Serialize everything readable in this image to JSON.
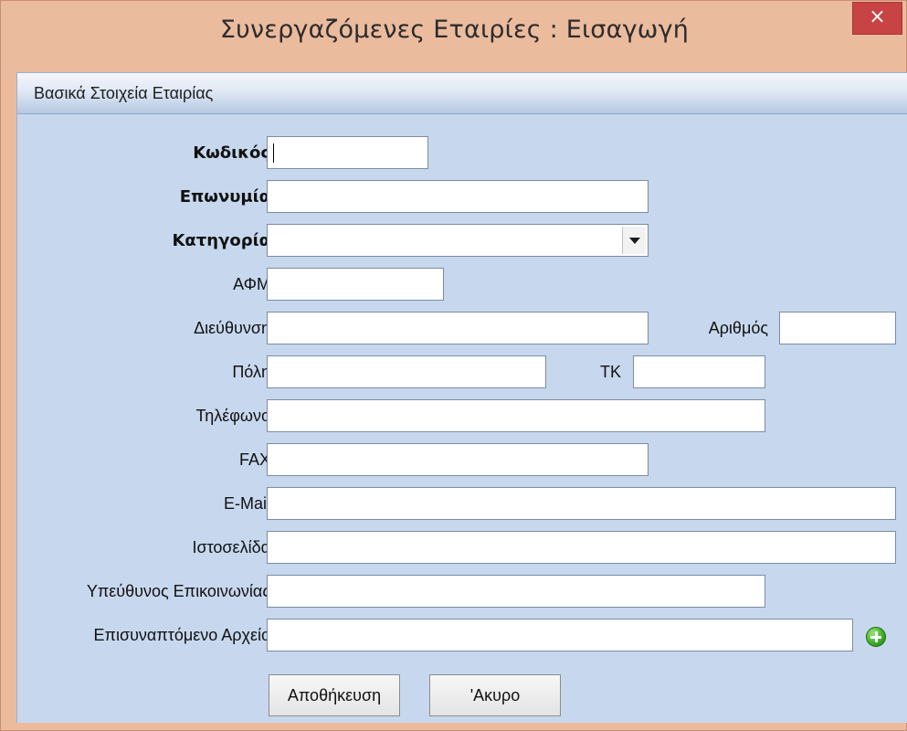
{
  "window": {
    "title": "Συνεργαζόμενες Εταιρίες : Εισαγωγή",
    "close_label": "×"
  },
  "section": {
    "title": "Βασικά Στοιχεία Εταιρίας"
  },
  "form": {
    "code": {
      "label": "Κωδικός",
      "value": ""
    },
    "name": {
      "label": "Επωνυμία",
      "value": ""
    },
    "category": {
      "label": "Κατηγορία",
      "value": ""
    },
    "vat": {
      "label": "ΑΦΜ",
      "value": ""
    },
    "address": {
      "label": "Διεύθυνση",
      "value": ""
    },
    "number": {
      "label": "Αριθμός",
      "value": ""
    },
    "city": {
      "label": "Πόλη",
      "value": ""
    },
    "postcode": {
      "label": "ΤΚ",
      "value": ""
    },
    "phone": {
      "label": "Τηλέφωνο",
      "value": ""
    },
    "fax": {
      "label": "FAX",
      "value": ""
    },
    "email": {
      "label": "E-Mail",
      "value": ""
    },
    "website": {
      "label": "Ιστοσελίδα",
      "value": ""
    },
    "contact": {
      "label": "Υπεύθυνος Επικοινωνίας",
      "value": ""
    },
    "attachment": {
      "label": "Επισυναπτόμενο Αρχείο",
      "value": ""
    }
  },
  "buttons": {
    "save": "Αποθήκευση",
    "cancel": "'Ακυρο"
  },
  "icons": {
    "add": "add-circle-icon",
    "dropdown": "chevron-down-icon",
    "close": "close-icon"
  },
  "colors": {
    "frame": "#ebbb9e",
    "client": "#c7d8ee",
    "close": "#c84343",
    "add": "#3fae2a"
  }
}
